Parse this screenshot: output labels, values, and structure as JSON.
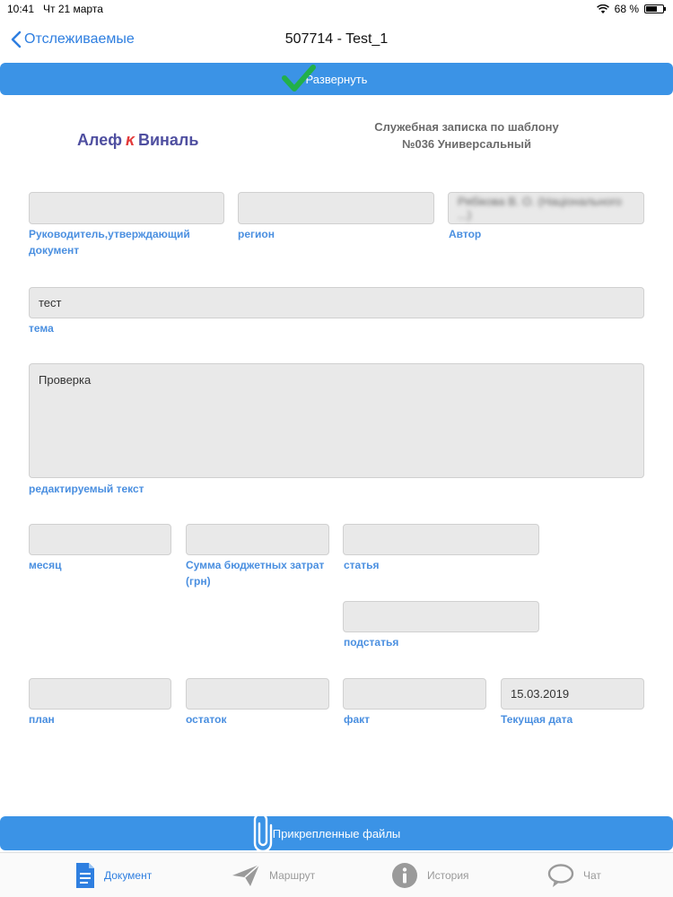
{
  "status": {
    "time": "10:41",
    "date": "Чт 21 марта",
    "battery": "68 %",
    "battery_level": 0.68
  },
  "nav": {
    "back_label": "Отслеживаемые",
    "title": "507714 - Test_1"
  },
  "expand_label": "Развернуть",
  "header": {
    "logo_left": "Алеф",
    "logo_mark": "ĸ",
    "logo_right": "Виналь",
    "doc_type_line1": "Служебная записка по шаблону",
    "doc_type_line2": "№036 Универсальный"
  },
  "fields": {
    "manager": {
      "value": "",
      "label": "Руководитель,утверждающий документ"
    },
    "region": {
      "value": "",
      "label": "регион"
    },
    "author": {
      "value": "Рябікова В. О. (Національного ...)",
      "label": "Автор"
    },
    "topic": {
      "value": "тест",
      "label": "тема"
    },
    "text": {
      "value": "Проверка",
      "label": "редактируемый текст"
    },
    "month": {
      "value": "",
      "label": "месяц"
    },
    "budget": {
      "value": "",
      "label": "Сумма бюджетных затрат (грн)"
    },
    "article": {
      "value": "",
      "label": "статья"
    },
    "subarticle": {
      "value": "",
      "label": "подстатья"
    },
    "plan": {
      "value": "",
      "label": "план"
    },
    "remainder": {
      "value": "",
      "label": "остаток"
    },
    "fact": {
      "value": "",
      "label": "факт"
    },
    "current_date": {
      "value": "15.03.2019",
      "label": "Текущая дата"
    }
  },
  "attach_label": "Прикрепленные файлы",
  "tabs": [
    {
      "label": "Документ",
      "icon": "document-icon"
    },
    {
      "label": "Маршрут",
      "icon": "paper-plane-icon"
    },
    {
      "label": "История",
      "icon": "info-icon"
    },
    {
      "label": "Чат",
      "icon": "chat-icon"
    }
  ],
  "colors": {
    "accent": "#3b93e6",
    "label": "#4a8fe0",
    "check": "#22b04a",
    "logo": "#4f4fa0",
    "logo_mark": "#e33b3b"
  }
}
